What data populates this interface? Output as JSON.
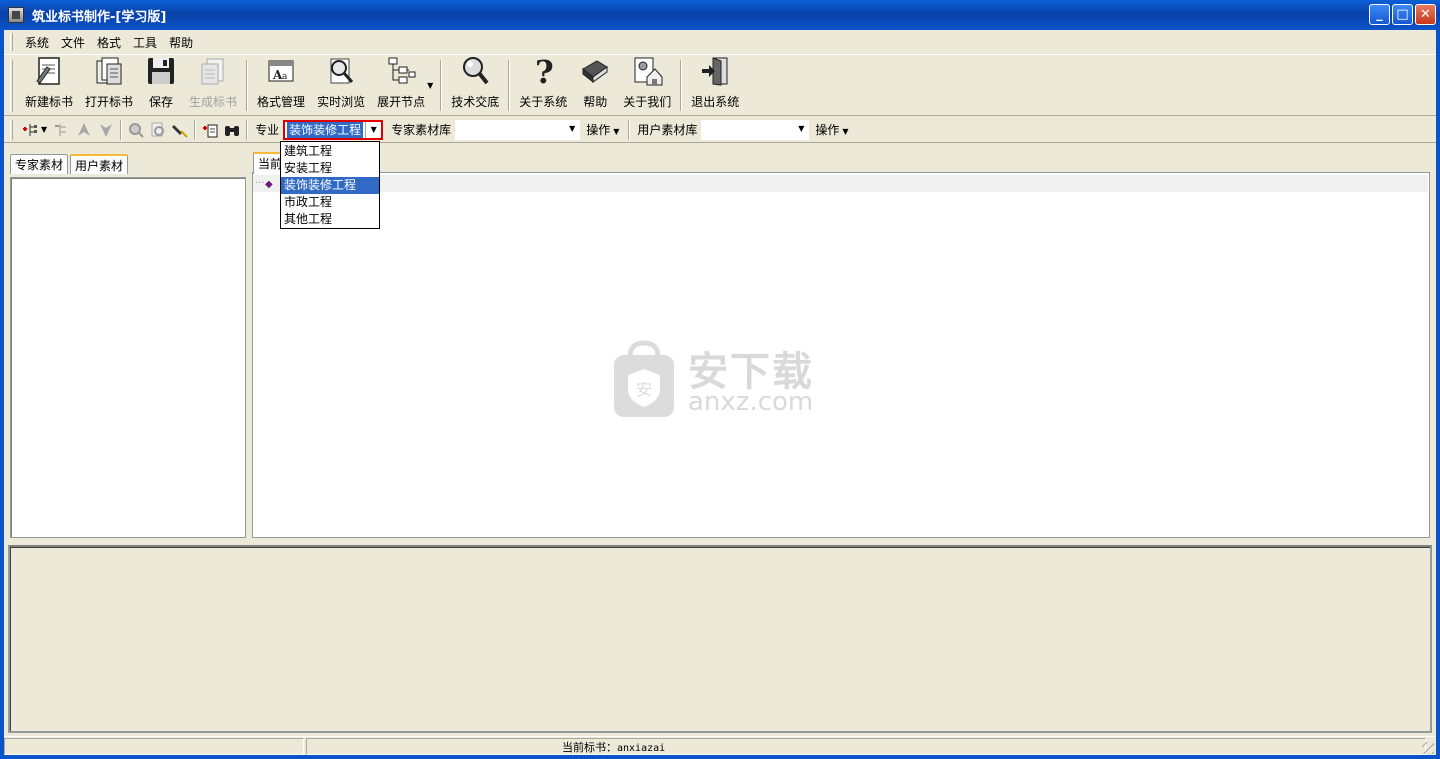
{
  "window": {
    "title": "筑业标书制作-[学习版]",
    "controls": {
      "minimize": "_",
      "maximize": "□",
      "close": "✕"
    }
  },
  "menu": {
    "items": [
      "系统",
      "文件",
      "格式",
      "工具",
      "帮助"
    ]
  },
  "toolbar": {
    "new_label": "新建标书",
    "open_label": "打开标书",
    "save_label": "保存",
    "generate_label": "生成标书",
    "format_label": "格式管理",
    "preview_label": "实时浏览",
    "expand_label": "展开节点",
    "tech_label": "技术交底",
    "about_system_label": "关于系统",
    "help_label": "帮助",
    "about_us_label": "关于我们",
    "exit_label": "退出系统"
  },
  "toolbar2": {
    "major_label": "专业",
    "major_value": "装饰装修工程",
    "expert_lib_label": "专家素材库",
    "expert_lib_value": "",
    "operate_label": "操作",
    "user_lib_label": "用户素材库",
    "user_lib_value": "",
    "operate2_label": "操作"
  },
  "dropdown": {
    "options": [
      "建筑工程",
      "安装工程",
      "装饰装修工程",
      "市政工程",
      "其他工程"
    ],
    "selected_index": 2
  },
  "left_tabs": [
    "专家素材",
    "用户素材"
  ],
  "left_active_tab": 1,
  "doc_tab": {
    "label": "当前"
  },
  "watermark": {
    "cn": "安下载",
    "en": "anxz.com",
    "shield": "安"
  },
  "status": {
    "label": "当前标书：",
    "value": "anxiazai"
  }
}
